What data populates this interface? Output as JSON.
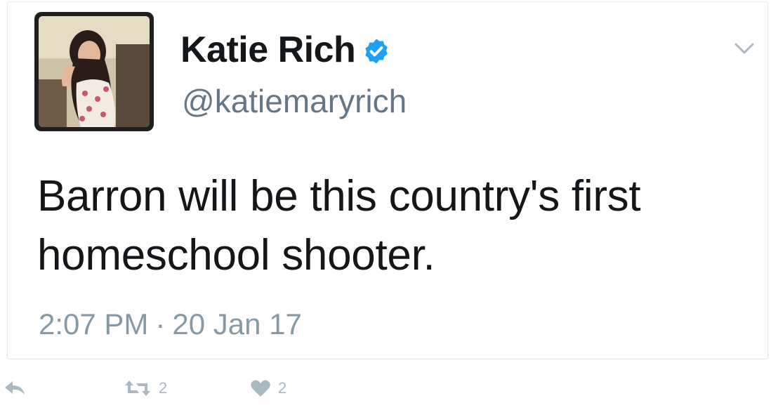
{
  "tweet": {
    "display_name": "Katie Rich",
    "handle": "@katiemaryrich",
    "text_line1": "Barron will be this country's first",
    "text_line2": "homeschool shooter.",
    "time": "2:07 PM",
    "separator": "·",
    "date": "20 Jan 17",
    "verified": true
  },
  "actions": {
    "reply_icon": "reply-arrow-icon",
    "retweet_icon": "retweet-icon",
    "retweet_count": "2",
    "like_icon": "heart-icon",
    "like_count": "2"
  },
  "colors": {
    "verified": "#1da1f2",
    "text": "#14171a",
    "muted": "#657786",
    "timestamp": "#8899a6",
    "action": "#aab8c2"
  }
}
